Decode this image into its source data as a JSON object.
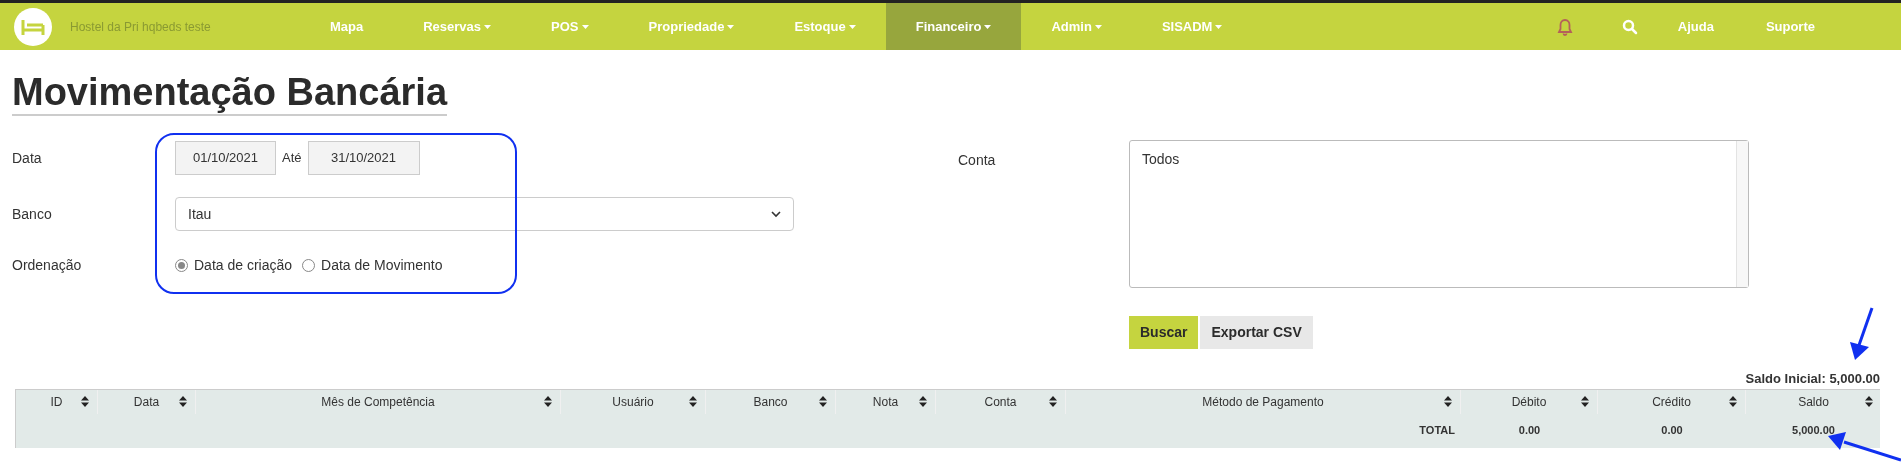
{
  "navbar": {
    "brand": "Hostel da Pri hqbeds teste",
    "menu": [
      {
        "label": "Mapa",
        "dropdown": false,
        "selected": false
      },
      {
        "label": "Reservas",
        "dropdown": true,
        "selected": false
      },
      {
        "label": "POS",
        "dropdown": true,
        "selected": false
      },
      {
        "label": "Propriedade",
        "dropdown": true,
        "selected": false
      },
      {
        "label": "Estoque",
        "dropdown": true,
        "selected": false
      },
      {
        "label": "Financeiro",
        "dropdown": true,
        "selected": true
      },
      {
        "label": "Admin",
        "dropdown": true,
        "selected": false
      },
      {
        "label": "SISADM",
        "dropdown": true,
        "selected": false
      }
    ],
    "links": [
      "Ajuda",
      "Suporte"
    ]
  },
  "page_title": "Movimentação Bancária",
  "form": {
    "data_label": "Data",
    "date_from": "01/10/2021",
    "until_label": "Até",
    "date_to": "31/10/2021",
    "banco_label": "Banco",
    "banco_value": "Itau",
    "ordenacao_label": "Ordenação",
    "ordenacao_options": [
      {
        "label": "Data de criação",
        "selected": true
      },
      {
        "label": "Data de Movimento",
        "selected": false
      }
    ],
    "conta_label": "Conta",
    "conta_value": "Todos"
  },
  "buttons": [
    "Buscar",
    "Exportar CSV"
  ],
  "saldo_inicial": "Saldo Inicial: 5,000.00",
  "table": {
    "columns": [
      "ID",
      "Data",
      "Mês de Competência",
      "Usuário",
      "Banco",
      "Nota",
      "Conta",
      "Método de Pagamento",
      "Débito",
      "Crédito",
      "Saldo"
    ],
    "total_row": [
      "TOTAL",
      "0.00",
      "0.00",
      "5,000.00"
    ]
  }
}
